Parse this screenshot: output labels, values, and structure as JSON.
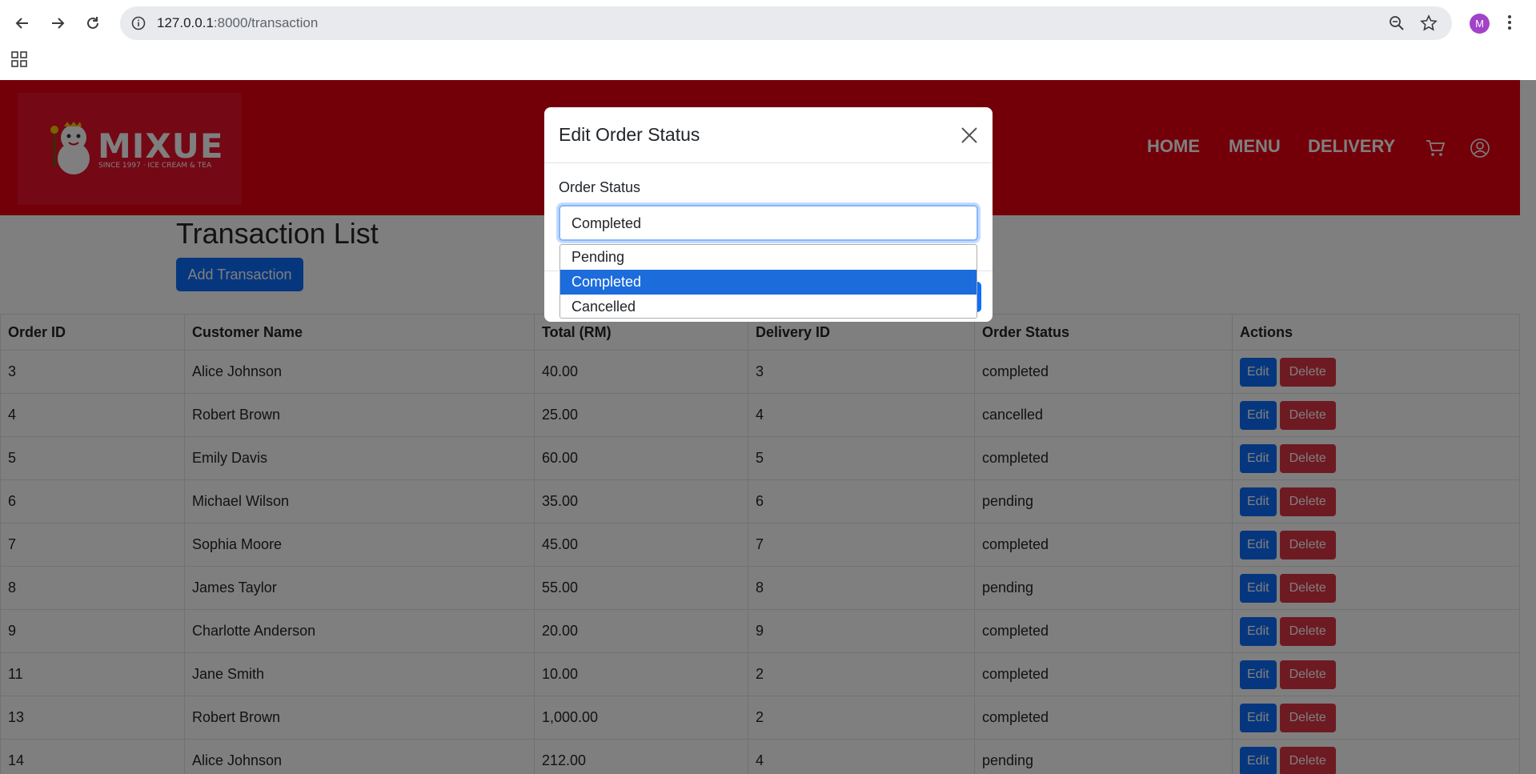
{
  "browser": {
    "url_host": "127.0.0.1",
    "url_path": ":8000/transaction",
    "profile_initial": "M"
  },
  "header": {
    "logo_text": "MIXUE",
    "logo_tagline": "SINCE 1997 · ICE CREAM & TEA",
    "nav": [
      "HOME",
      "MENU",
      "DELIVERY"
    ]
  },
  "main": {
    "title": "Transaction List",
    "add_button": "Add Transaction",
    "columns": [
      "Order ID",
      "Customer Name",
      "Total (RM)",
      "Delivery ID",
      "Order Status",
      "Actions"
    ],
    "edit_label": "Edit",
    "delete_label": "Delete",
    "rows": [
      [
        "3",
        "Alice Johnson",
        "40.00",
        "3",
        "completed"
      ],
      [
        "4",
        "Robert Brown",
        "25.00",
        "4",
        "cancelled"
      ],
      [
        "5",
        "Emily Davis",
        "60.00",
        "5",
        "completed"
      ],
      [
        "6",
        "Michael Wilson",
        "35.00",
        "6",
        "pending"
      ],
      [
        "7",
        "Sophia Moore",
        "45.00",
        "7",
        "completed"
      ],
      [
        "8",
        "James Taylor",
        "55.00",
        "8",
        "pending"
      ],
      [
        "9",
        "Charlotte Anderson",
        "20.00",
        "9",
        "completed"
      ],
      [
        "11",
        "Jane Smith",
        "10.00",
        "2",
        "completed"
      ],
      [
        "13",
        "Robert Brown",
        "1,000.00",
        "2",
        "completed"
      ],
      [
        "14",
        "Alice Johnson",
        "212.00",
        "4",
        "pending"
      ]
    ]
  },
  "modal": {
    "title": "Edit Order Status",
    "field_label": "Order Status",
    "selected_value": "Completed",
    "options": [
      "Pending",
      "Completed",
      "Cancelled"
    ],
    "selected_index": 1
  },
  "colors": {
    "brand_red": "#e60012",
    "primary": "#0d6efd",
    "danger": "#dc3545",
    "option_highlight": "#1c6cdc"
  }
}
